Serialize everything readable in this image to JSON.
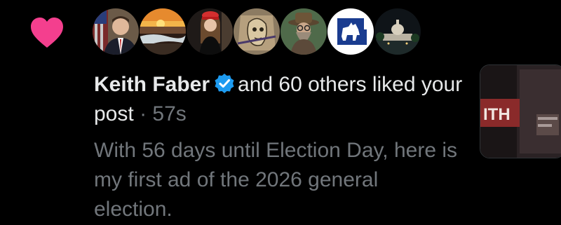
{
  "notification": {
    "type_icon": "heart-icon",
    "accent_color": "#f91880",
    "avatars": [
      {
        "name": "avatar-1",
        "desc": "man in suit with flag"
      },
      {
        "name": "avatar-2",
        "desc": "sunset beach"
      },
      {
        "name": "avatar-3",
        "desc": "woman in red cap"
      },
      {
        "name": "avatar-4",
        "desc": "sketch portrait"
      },
      {
        "name": "avatar-5",
        "desc": "man with hat and beard"
      },
      {
        "name": "avatar-6",
        "desc": "donkey logo on blue"
      },
      {
        "name": "avatar-7",
        "desc": "capitol at night"
      }
    ],
    "actor_name": "Keith Faber",
    "verified_icon": "verified-badge-icon",
    "action_text": "and 60 others liked your post",
    "separator": "·",
    "timestamp": "57s",
    "post_text": "With 56 days until Election Day, here is my first ad of the 2026 general election.",
    "thumbnail_text": "ITH"
  }
}
